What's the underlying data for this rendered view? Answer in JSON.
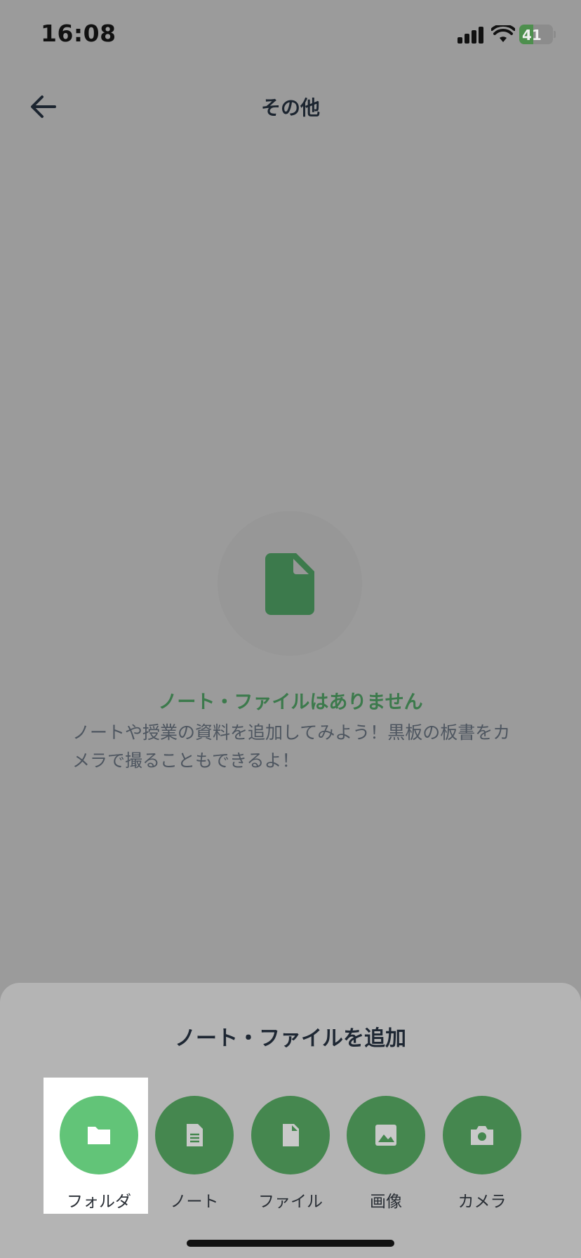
{
  "status_bar": {
    "time": "16:08",
    "battery": "41",
    "battery_level": 0.41,
    "icons": [
      "signal-icon",
      "wifi-icon",
      "battery-charging-icon"
    ]
  },
  "header": {
    "title": "その他",
    "back_icon": "arrow-left-icon"
  },
  "empty_state": {
    "icon": "file-icon",
    "title": "ノート・ファイルはありません",
    "description": "ノートや授業の資料を追加してみよう！黒板の板書をカメラで撮ることもできるよ！"
  },
  "sheet": {
    "title": "ノート・ファイルを追加",
    "actions": [
      {
        "label": "フォルダ",
        "icon": "folder-icon",
        "selected": true
      },
      {
        "label": "ノート",
        "icon": "note-icon",
        "selected": false
      },
      {
        "label": "ファイル",
        "icon": "file-icon",
        "selected": false
      },
      {
        "label": "画像",
        "icon": "image-icon",
        "selected": false
      },
      {
        "label": "カメラ",
        "icon": "camera-icon",
        "selected": false
      }
    ]
  },
  "colors": {
    "overlay_bg": "#9b9b9b",
    "sheet_bg": "#b4b4b4",
    "accent": "#45874f",
    "accent_active": "#62c478",
    "title_green": "#3c7a4c"
  }
}
